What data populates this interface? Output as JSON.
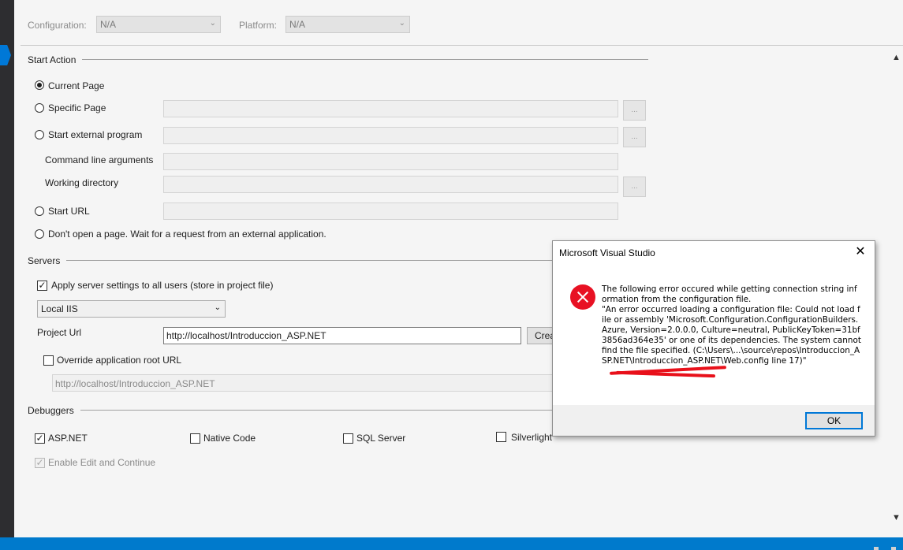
{
  "header": {
    "configuration_label": "Configuration:",
    "configuration_value": "N/A",
    "platform_label": "Platform:",
    "platform_value": "N/A"
  },
  "start_action": {
    "title": "Start Action",
    "current_page": "Current Page",
    "specific_page": "Specific Page",
    "start_external_program": "Start external program",
    "command_line_arguments": "Command line arguments",
    "working_directory": "Working directory",
    "start_url": "Start URL",
    "dont_open": "Don't open a page.  Wait for a request from an external application.",
    "browse_label": "..."
  },
  "servers": {
    "title": "Servers",
    "apply_settings": "Apply server settings to all users (store in project file)",
    "server_value": "Local IIS",
    "project_url_label": "Project Url",
    "project_url_value": "http://localhost/Introduccion_ASP.NET",
    "create_button": "Crea",
    "override_root": "Override application root URL",
    "override_root_value": "http://localhost/Introduccion_ASP.NET"
  },
  "debuggers": {
    "title": "Debuggers",
    "aspnet": "ASP.NET",
    "native_code": "Native Code",
    "sql_server": "SQL Server",
    "silverlight": "Silverlight",
    "edit_continue": "Enable Edit and Continue"
  },
  "dialog": {
    "title": "Microsoft Visual Studio",
    "message": "The following error occured while getting connection string information from the configuration file.\n\"An error occurred loading a configuration file: Could not load file or assembly 'Microsoft.Configuration.ConfigurationBuilders.Azure, Version=2.0.0.0, Culture=neutral, PublicKeyToken=31bf3856ad364e35' or one of its dependencies. The system cannot find the file specified. (C:\\Users\\...\\source\\repos\\Introduccion_ASP.NET\\Introduccion_ASP.NET\\Web.config line 17)\"",
    "ok_button": "OK",
    "close_glyph": "✕"
  },
  "colors": {
    "accent": "#0078d7",
    "status_bar": "#007acc",
    "error": "#e81123",
    "redaction": "#e8101a"
  }
}
